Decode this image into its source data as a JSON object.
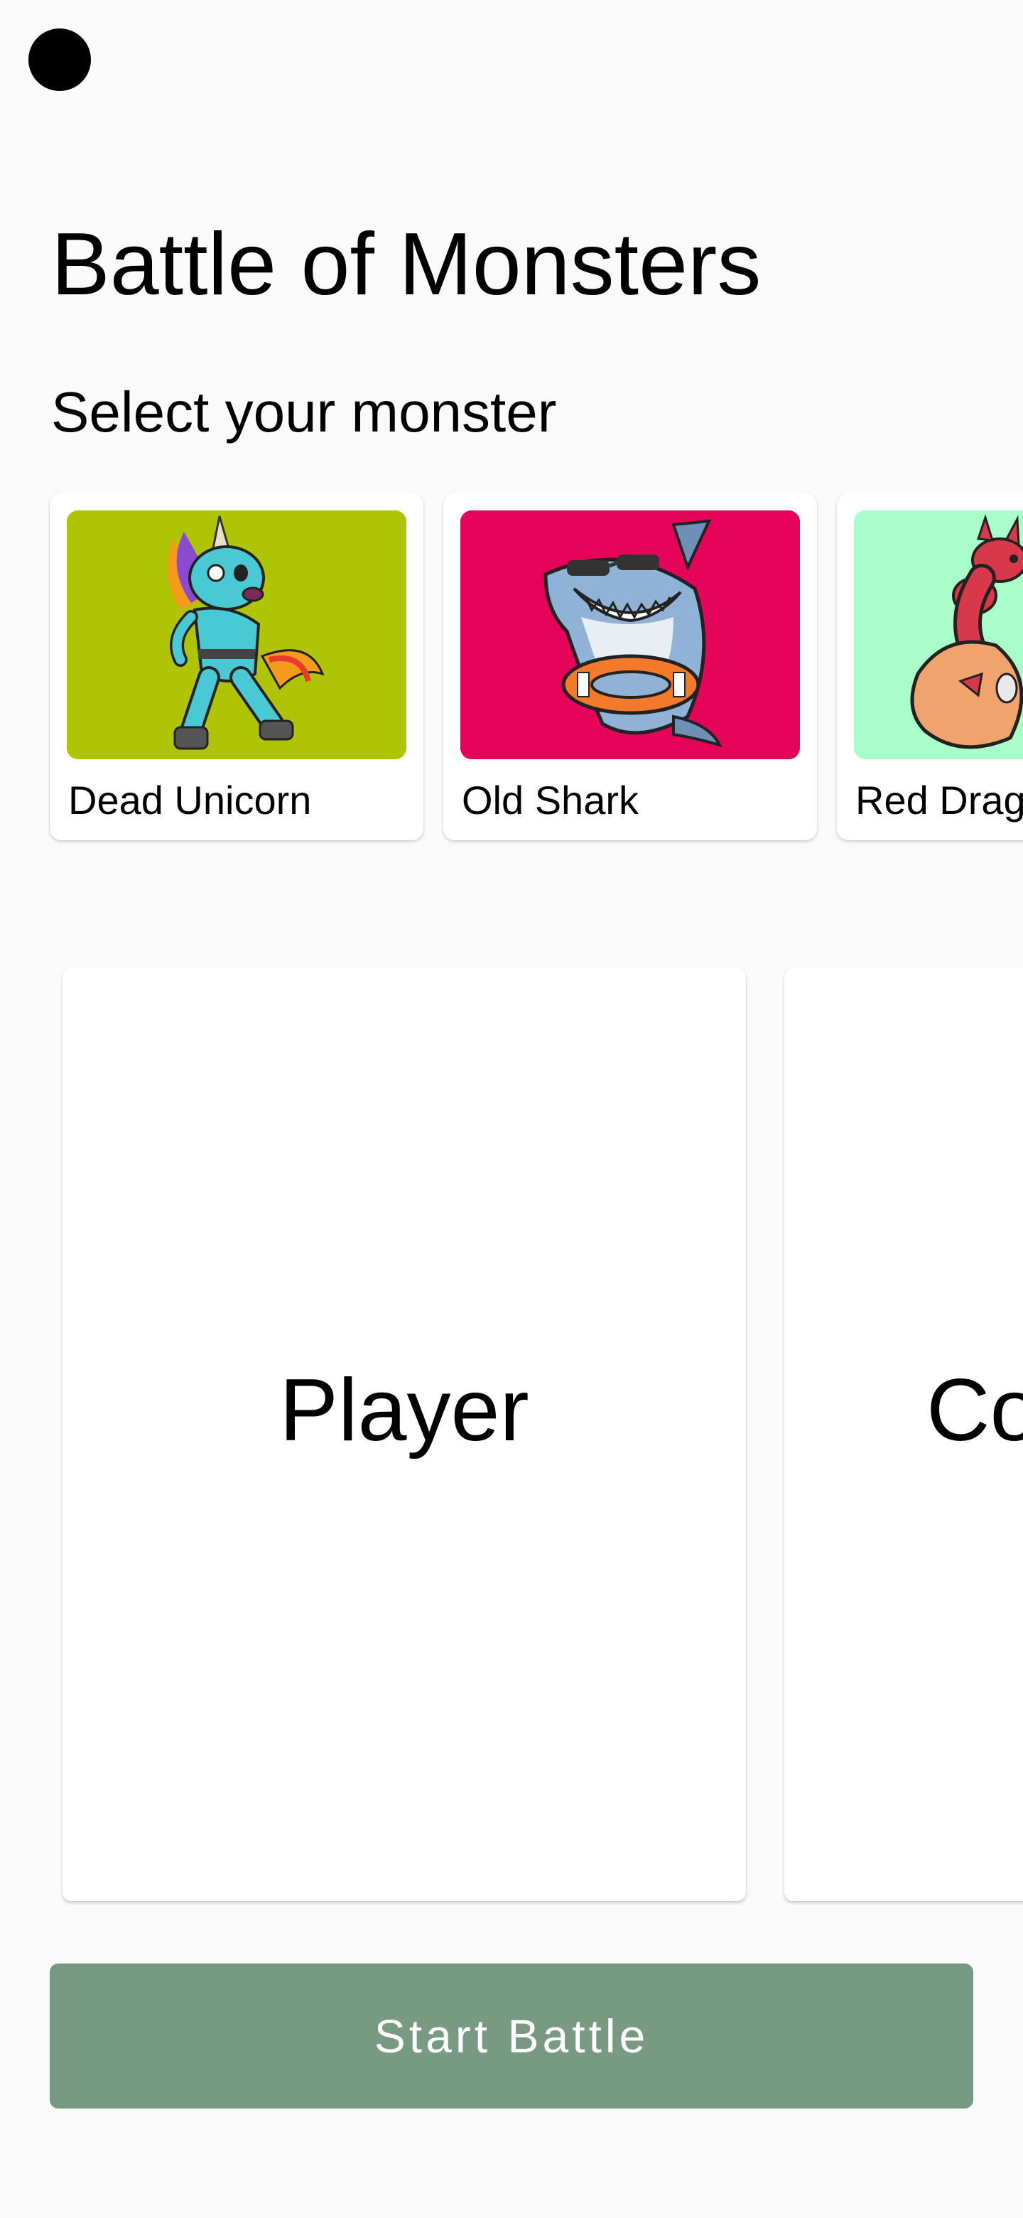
{
  "app": {
    "title": "Battle of Monsters",
    "subtitle": "Select your monster"
  },
  "monsters": [
    {
      "name": "Dead Unicorn",
      "bg_color": "#afc404",
      "icon": "zombie-unicorn-icon"
    },
    {
      "name": "Old Shark",
      "bg_color": "#e6045a",
      "icon": "shark-icon"
    },
    {
      "name": "Red Drago",
      "bg_color": "#a9fdc9",
      "icon": "red-dragon-icon"
    }
  ],
  "battle": {
    "player_label": "Player",
    "computer_label": "Co"
  },
  "actions": {
    "start_label": "Start Battle",
    "start_color": "#799a82"
  }
}
